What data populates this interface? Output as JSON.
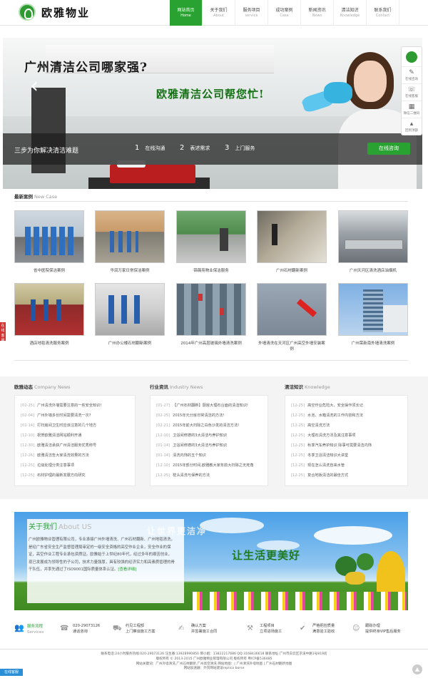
{
  "header": {
    "logo_text": "欧雅物业",
    "nav": [
      {
        "cn": "网站首页",
        "en": "Home",
        "active": true
      },
      {
        "cn": "关于我们",
        "en": "About",
        "active": false
      },
      {
        "cn": "服务项目",
        "en": "service",
        "active": false
      },
      {
        "cn": "成功案例",
        "en": "Case",
        "active": false
      },
      {
        "cn": "新闻资讯",
        "en": "News",
        "active": false
      },
      {
        "cn": "清洁知识",
        "en": "Knowledge",
        "active": false
      },
      {
        "cn": "联系我们",
        "en": "Contact",
        "active": false
      }
    ]
  },
  "banner": {
    "slogan1": "广州清洁公司哪家强?",
    "slogan2": "欧雅清洁公司帮您忙!",
    "steps_title": "三步为你解决清洁难题",
    "steps": [
      {
        "num": "1",
        "label": "在线沟通"
      },
      {
        "num": "2",
        "label": "表述需求"
      },
      {
        "num": "3",
        "label": "上门服务"
      }
    ],
    "consult_button": "在线咨询"
  },
  "side_toolbar": {
    "items": [
      {
        "icon": "chat-icon",
        "label": "在线咨询"
      },
      {
        "icon": "phone-icon",
        "label": "在线客服"
      },
      {
        "icon": "qrcode-icon",
        "label": "微信二维码"
      },
      {
        "icon": "top-icon",
        "label": "回到顶部"
      }
    ]
  },
  "cases": {
    "title": "最新案例",
    "title_en": "New Case",
    "items": [
      "省中医院保洁案例",
      "华润万家日常保洁案例",
      "锦薇苑物业保洁服务",
      "广州石材翻新案例",
      "广州天河区清洗酒店油烟机",
      "酒店地毯清洗服务案例",
      "广州办公楼石材翻新案例",
      "2014年广州高层玻璃外墙清洗案例",
      "外墙清洗在天河区广州高空外墙安装案例",
      "广州荣新南外墙清洗案例"
    ]
  },
  "news": {
    "company": {
      "title": "欧雅动态",
      "title_en": "Company News",
      "items": [
        {
          "date": "02-25",
          "text": "广州清洗外墙需要注意的一些安全知识!"
        },
        {
          "date": "02-04",
          "text": "广州外墙多长时间需要清洗一次?"
        },
        {
          "date": "01-14",
          "text": "打扫房间卫生时应该注意的几个地方"
        },
        {
          "date": "12-10",
          "text": "祝贺欧雅清洁网站顺利开通"
        },
        {
          "date": "12-30",
          "text": "欧雅清洁承获广州清洁服务优秀称号"
        },
        {
          "date": "12-26",
          "text": "欧雅清洁告大家清洗效果的方法"
        },
        {
          "date": "12-25",
          "text": "垃圾处理分类注意事项"
        },
        {
          "date": "12-25",
          "text": "石材护理的最新发展方向研究"
        }
      ]
    },
    "industry": {
      "title": "行业资讯",
      "title_en": "Industry News",
      "items": [
        {
          "date": "01-27",
          "text": "【广州石材翻新】厨房大理石台面的清洁知识!"
        },
        {
          "date": "02-25",
          "text": "2015年元分房日常清洁的方法!"
        },
        {
          "date": "02-21",
          "text": "2015年前大扫除之白色沙发的清洁方法!"
        },
        {
          "date": "12-10",
          "text": "卫浴间修德的3大清洁与养护知识"
        },
        {
          "date": "01-14",
          "text": "卫浴间修德的3大清洁与养护知识"
        },
        {
          "date": "01-14",
          "text": "清洗内饰的五个知识"
        },
        {
          "date": "12-10",
          "text": "2015年部分时间,欧雅教大家年前大扫除之无死角"
        },
        {
          "date": "12-25",
          "text": "枕头清洗与保养的方法"
        }
      ]
    },
    "knowledge": {
      "title": "清洁知识",
      "title_en": "Knowledge",
      "items": [
        {
          "date": "12-25",
          "text": "高空作业危险大，安全操作须长记"
        },
        {
          "date": "12-25",
          "text": "水池、水箱清洗的工作内容和方法"
        },
        {
          "date": "12-25",
          "text": "高空清洗方法"
        },
        {
          "date": "12-25",
          "text": "大理石清洗方法及其注意事项"
        },
        {
          "date": "12-25",
          "text": "秋季汽车养护知识 除事可需要清洁内饰"
        },
        {
          "date": "12-25",
          "text": "冬季卫浴清洁知识大讲堂"
        },
        {
          "date": "12-25",
          "text": "现在怎么清洗自来水管"
        },
        {
          "date": "12-25",
          "text": "复合地板清洁的最佳方式"
        }
      ]
    }
  },
  "about": {
    "title": "关于我们",
    "title_en": "About US",
    "text": "广州欧雅物业管理有限公司，专业承接广州外墙清洗、广州石材翻新、广州地毯清洗，是经广东省安全生产监督管理局审定的一级安全资格的高空作业企业，安全作业的保证，高空作业工程专业承包资质证。欧雅始于上世纪80年代，经过多年的艰苦创业，现已发展成为领导性的子公司，技术力量强厚，具有较强的经济实力和高素质管理的骨干队伍，并率先通过了ISO9001国际质量体系认证。",
    "more": "[查看详细]",
    "slogan1": "让世界更洁净",
    "slogan2": "让生活更美好"
  },
  "services": {
    "main_label": "服务流程",
    "main_en": "Services",
    "items": [
      {
        "icon": "phone-icon",
        "line1": "020-29073126",
        "line2": "通话咨询"
      },
      {
        "icon": "car-icon",
        "line1": "约见工程部",
        "line2": "上门察谈施工方案"
      },
      {
        "icon": "handshake-icon",
        "line1": "确认方案",
        "line2": "并签署施工合同"
      },
      {
        "icon": "tools-icon",
        "line1": "工程项目",
        "line2": "立项进场施工"
      },
      {
        "icon": "check-icon",
        "line1": "严格把控质量",
        "line2": "满意验工验收"
      },
      {
        "icon": "service-icon",
        "line1": "跟踪办理",
        "line2": "提供终身VIP售后服务"
      }
    ]
  },
  "footer": {
    "line1": "联系电话:24小时服务热线:020-29073126 汪生番:13928990850 郝小姐：13822217686 QQ:3168436618 联系地址:广州市白云区京溪中路1号819房",
    "line2": "版权所有 © 2013-2015 广州欧雅物业管理有限公司 版权所有 粤ICP备536485",
    "line3": "网站关键词：广州外墙清洗,广州石材翻新,广州高空清洗 网站地图：| 广州清洗外墙地图 | 广州石材翻新地图",
    "line4": "网站加速器：外贸网站建设replica borse"
  },
  "float": {
    "left_label": "在线客服",
    "bottom_label": "在线客服",
    "top_label": "▲"
  },
  "colors": {
    "brand_green": "#2aa232",
    "dark_green": "#146f14"
  }
}
